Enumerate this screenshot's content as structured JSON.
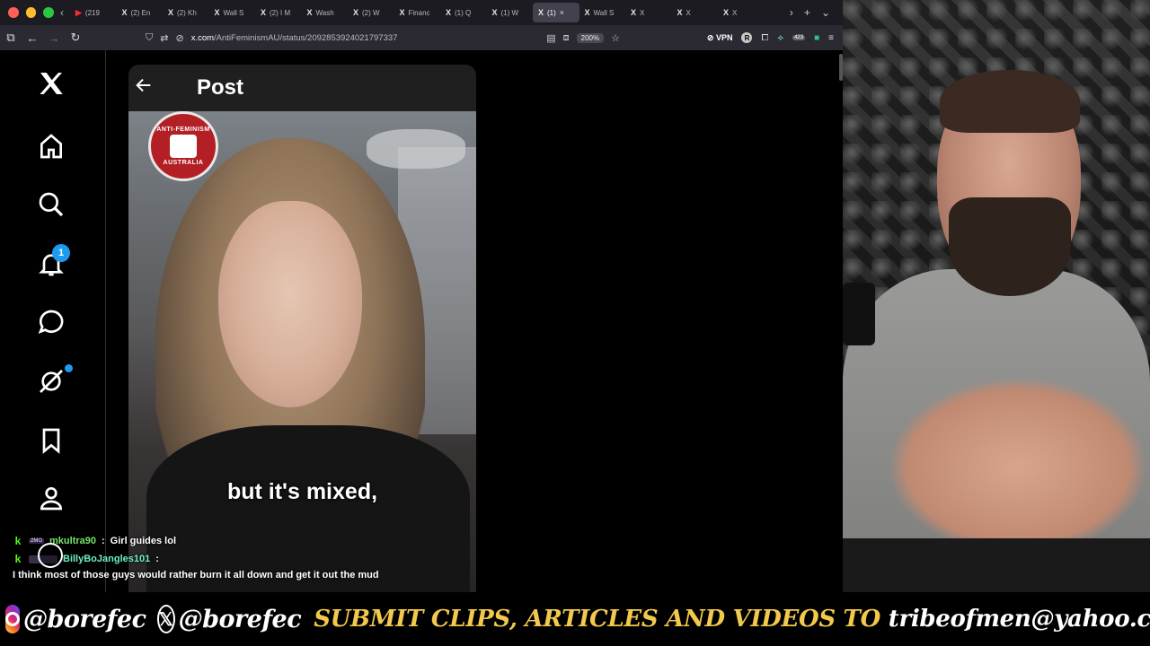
{
  "browser": {
    "tabs": [
      {
        "icon": "youtube-icon",
        "label": "(219",
        "active": false
      },
      {
        "icon": "x-icon",
        "label": "(2) En",
        "active": false
      },
      {
        "icon": "x-icon",
        "label": "(2) Kh",
        "active": false
      },
      {
        "icon": "x-icon",
        "label": "Wall S",
        "active": false
      },
      {
        "icon": "x-icon",
        "label": "(2) I M",
        "active": false
      },
      {
        "icon": "x-icon",
        "label": "Wash",
        "active": false
      },
      {
        "icon": "x-icon",
        "label": "(2) W",
        "active": false
      },
      {
        "icon": "x-icon",
        "label": "Financ",
        "active": false
      },
      {
        "icon": "x-icon",
        "label": "(1) Q",
        "active": false
      },
      {
        "icon": "x-icon",
        "label": "(1) W",
        "active": false
      },
      {
        "icon": "x-icon",
        "label": "(1)",
        "active": true
      },
      {
        "icon": "x-icon",
        "label": "Wall S",
        "active": false
      },
      {
        "icon": "x-icon",
        "label": "X",
        "active": false
      },
      {
        "icon": "x-icon",
        "label": "X",
        "active": false
      },
      {
        "icon": "x-icon",
        "label": "X",
        "active": false
      }
    ],
    "url_host": "x.com",
    "url_path": "/AntiFeminismAU/status/2092853924021797337",
    "zoom": "200%",
    "vpn_label": "VPN",
    "ext_badge": "R",
    "ext_count": "423"
  },
  "x_app": {
    "notification_count": "1",
    "post_title": "Post"
  },
  "video": {
    "seal_top": "ANTI-FEMINISM",
    "seal_bottom": "AUSTRALIA",
    "caption": "but it's mixed,"
  },
  "chat": {
    "messages": [
      {
        "platform": "k",
        "badge": "2MO",
        "user": "mkultra90",
        "sep": ":",
        "text": "Girl guides lol"
      },
      {
        "platform": "k",
        "badge": "",
        "user": "BillyBoJangles101",
        "sep": ":",
        "text": ""
      }
    ],
    "continuation": "I think most of those guys would rather burn it all down and get it out the mud"
  },
  "banner": {
    "ig_handle": "@borefec",
    "x_handle": "@borefec",
    "message": "SUBMIT CLIPS, ARTICLES AND VIDEOS TO",
    "email": "tribeofmen@yahoo.com"
  },
  "colors": {
    "x_blue": "#1d9bf0",
    "kick_green": "#53fc18",
    "banner_yellow": "#f2c94c"
  }
}
